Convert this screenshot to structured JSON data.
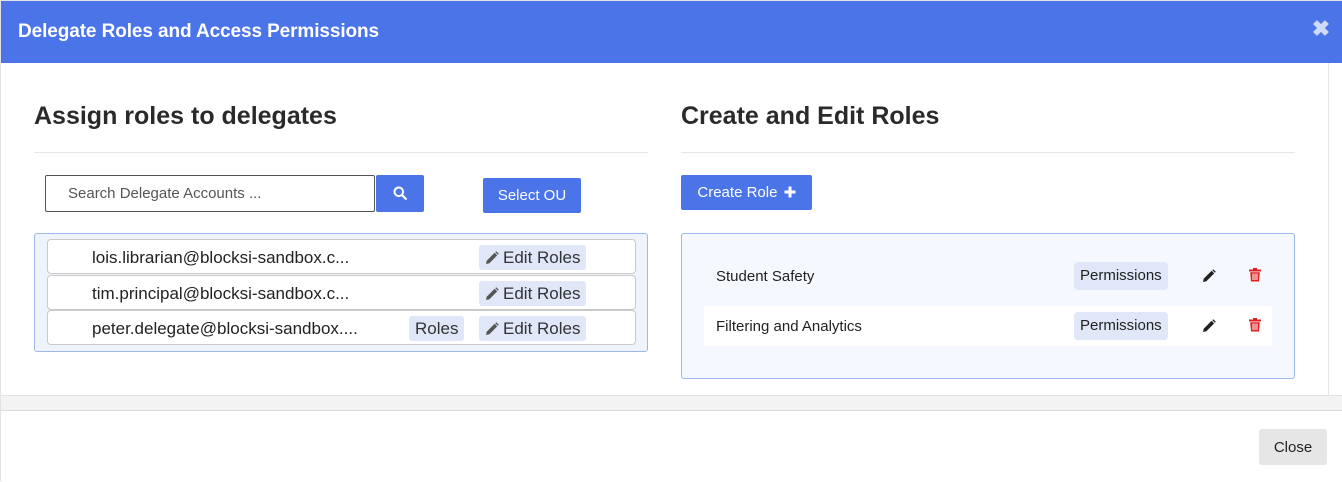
{
  "dialog": {
    "title": "Delegate Roles and Access Permissions",
    "close_glyph": "✖"
  },
  "assign": {
    "heading": "Assign roles to delegates",
    "search": {
      "placeholder": "Search Delegate Accounts ...",
      "value": ""
    },
    "select_ou_label": "Select OU",
    "delegates": [
      {
        "email": "lois.librarian@blocksi-sandbox.c...",
        "roles_label": null,
        "edit_label": "Edit Roles"
      },
      {
        "email": "tim.principal@blocksi-sandbox.c...",
        "roles_label": null,
        "edit_label": "Edit Roles"
      },
      {
        "email": "peter.delegate@blocksi-sandbox....",
        "roles_label": "Roles",
        "edit_label": "Edit Roles"
      }
    ]
  },
  "roles": {
    "heading": "Create and Edit Roles",
    "create_label": "Create Role",
    "create_icon": "plus-icon",
    "items": [
      {
        "name": "Student Safety",
        "permissions_label": "Permissions"
      },
      {
        "name": "Filtering and Analytics",
        "permissions_label": "Permissions"
      }
    ]
  },
  "footer": {
    "close_label": "Close"
  },
  "colors": {
    "accent": "#4a74e8",
    "pill": "#dfe7f8",
    "delete": "#e02020"
  }
}
